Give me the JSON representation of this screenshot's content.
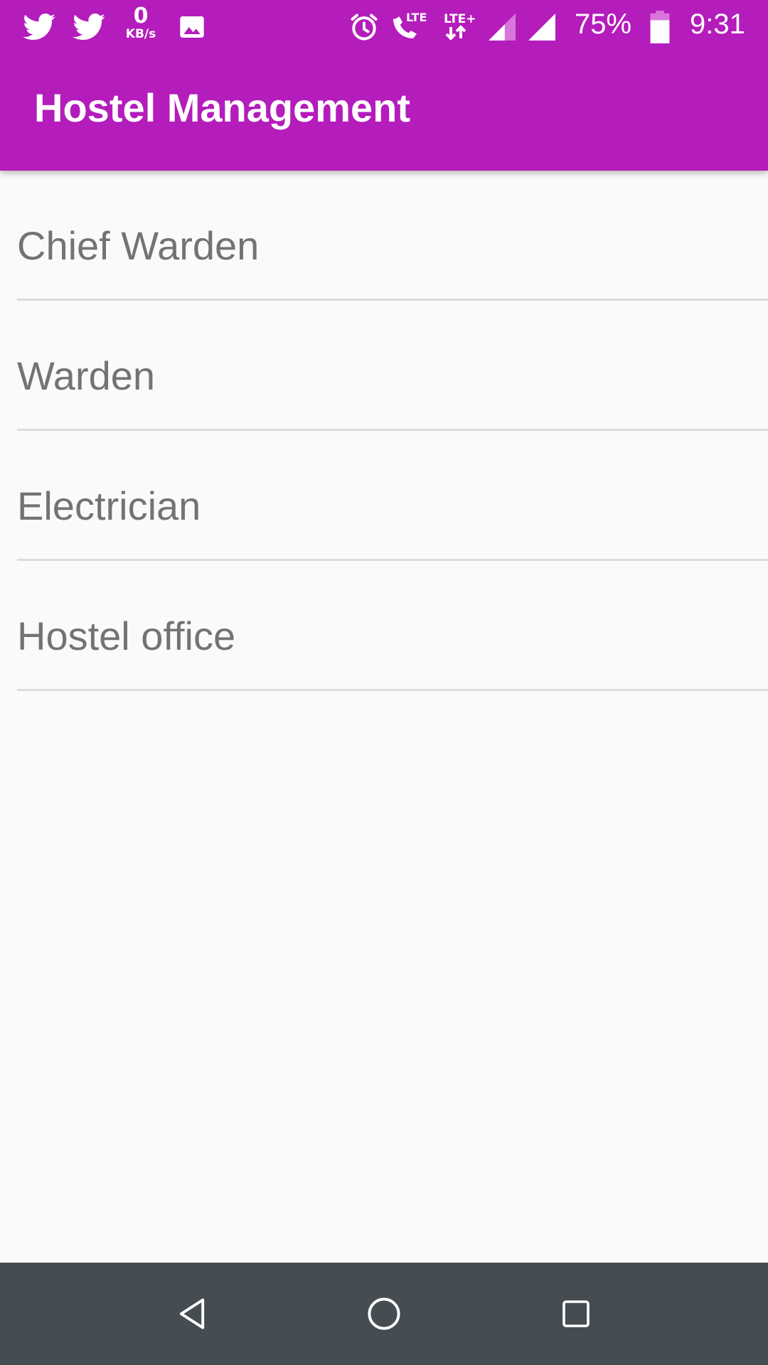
{
  "status_bar": {
    "left_icons": [
      "twitter-icon",
      "twitter-icon",
      "network-speed",
      "image-icon"
    ],
    "network_speed_value": "0",
    "network_speed_unit": "KB/s",
    "right_icons": [
      "alarm-icon",
      "lte-call-icon",
      "lte-plus-data-icon",
      "signal-icon",
      "signal-icon",
      "battery-icon"
    ],
    "lte_label": "LTE",
    "lte_plus_label": "LTE+",
    "battery_percent": "75%",
    "time": "9:31"
  },
  "app_bar": {
    "title": "Hostel Management"
  },
  "list": {
    "items": [
      {
        "label": "Chief Warden"
      },
      {
        "label": "Warden"
      },
      {
        "label": "Electrician"
      },
      {
        "label": "Hostel office"
      }
    ]
  },
  "nav_bar": {
    "buttons": [
      "back-icon",
      "home-icon",
      "recents-icon"
    ]
  },
  "colors": {
    "primary": "#b41cbb",
    "background": "#fafafa",
    "list_text": "#737373",
    "divider": "#dcdcdc",
    "nav_bar": "#464d52"
  }
}
